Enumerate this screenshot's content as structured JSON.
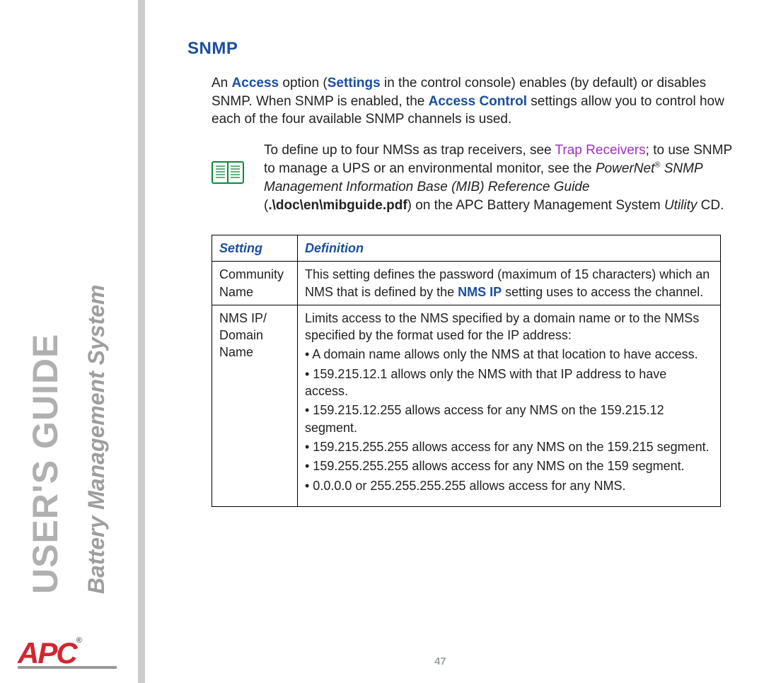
{
  "sidebar": {
    "guide": "USER'S GUIDE",
    "subtitle": "Battery Management System",
    "logo": "APC",
    "logo_reg": "®"
  },
  "page_number": "47",
  "section_title": "SNMP",
  "intro": {
    "t1": "An ",
    "access": "Access",
    "t2": " option (",
    "settings": "Settings",
    "t3": " in the control console) enables (by default) or disables SNMP. When SNMP is enabled, the ",
    "ac": "Access Control",
    "t4": " settings allow you to control how each of the four available SNMP channels is used."
  },
  "note": {
    "t1": "To define up to four NMSs as trap receivers, see ",
    "link": "Trap Receivers",
    "t2": "; to use SNMP to manage a UPS or an environmental monitor, see the ",
    "it1": "PowerNet",
    "reg": "®",
    "it2": " SNMP Management Information Base (MIB) Reference Guide",
    "t3": " (",
    "path": ".\\doc\\en\\mibguide.pdf",
    "t4": ") on the APC Battery Management System ",
    "it3": "Utility",
    "t5": " CD."
  },
  "table": {
    "h1": "Setting",
    "h2": "Definition",
    "r1c1": "Community Name",
    "r1c2a": "This setting defines the password (maximum of 15 characters) which an NMS that is defined by the ",
    "r1c2b": "NMS IP",
    "r1c2c": " setting uses to access the channel.",
    "r2c1": "NMS IP/ Domain Name",
    "r2lead": "Limits access to the NMS specified by a domain name or to the NMSs specified by the format used for the IP address:",
    "b1": "• A domain name allows only the NMS at that location to have access.",
    "b2": "• 159.215.12.1 allows only the NMS with that IP address to have access.",
    "b3": "• 159.215.12.255 allows access for any NMS on the 159.215.12 segment.",
    "b4": "• 159.215.255.255 allows access for any NMS on the 159.215 segment.",
    "b5": "• 159.255.255.255 allows access for any NMS on the 159 segment.",
    "b6": "• 0.0.0.0 or 255.255.255.255 allows access for any NMS."
  }
}
